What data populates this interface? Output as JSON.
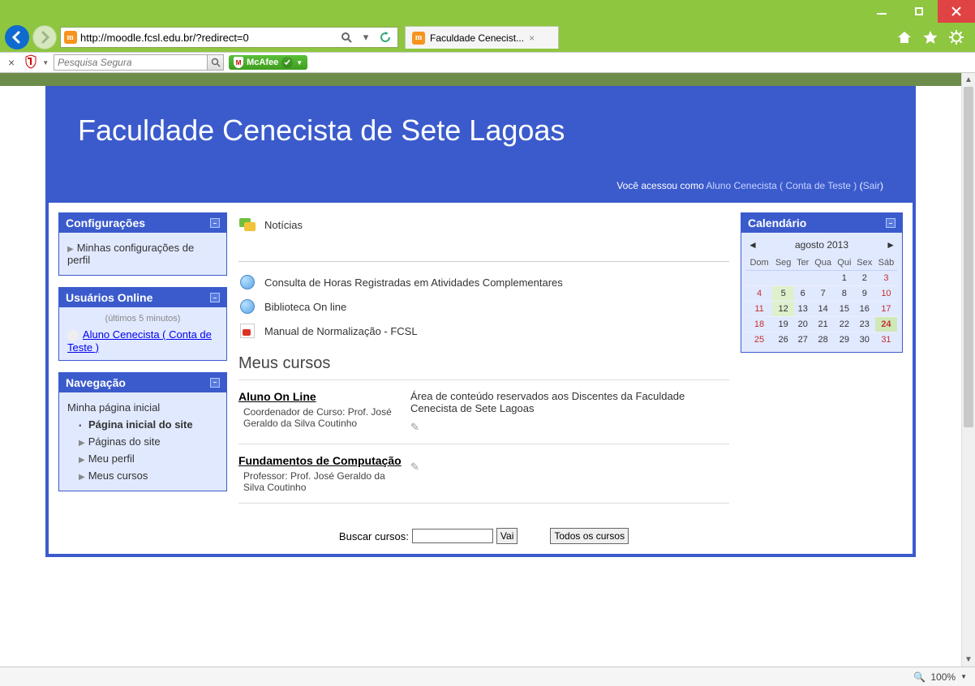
{
  "window": {
    "url": "http://moodle.fcsl.edu.br/?redirect=0",
    "tab_title": "Faculdade Cenecist...",
    "zoom": "100%"
  },
  "toolbar": {
    "search_placeholder": "Pesquisa Segura",
    "mcafee_label": "McAfee"
  },
  "header": {
    "title": "Faculdade Cenecista de Sete Lagoas",
    "login_prefix": "Você acessou como ",
    "user_link": "Aluno Cenecista ( Conta de Teste )",
    "logout_label": "Sair"
  },
  "blocks": {
    "config": {
      "title": "Configurações",
      "item1": "Minhas configurações de perfil"
    },
    "online": {
      "title": "Usuários Online",
      "sub": "(últimos 5 minutos)",
      "user": "Aluno Cenecista ( Conta de Teste )"
    },
    "nav": {
      "title": "Navegação",
      "home": "Minha página inicial",
      "site_home": "Página inicial do site",
      "site_pages": "Páginas do site",
      "profile": "Meu perfil",
      "courses": "Meus cursos"
    },
    "calendar": {
      "title": "Calendário",
      "month": "agosto 2013",
      "days": [
        "Dom",
        "Seg",
        "Ter",
        "Qua",
        "Qui",
        "Sex",
        "Sáb"
      ]
    }
  },
  "main": {
    "news": "Notícias",
    "link1": "Consulta de Horas Registradas em Atividades Complementares",
    "link2": "Biblioteca On line",
    "link3": "Manual de Normalização - FCSL",
    "mycourses": "Meus cursos",
    "course1": {
      "title": "Aluno On Line",
      "info": "Coordenador de Curso: Prof. José Geraldo da Silva Coutinho",
      "desc": "Área de conteúdo reservados aos Discentes da Faculdade Cenecista de Sete Lagoas"
    },
    "course2": {
      "title": "Fundamentos de Computação",
      "info": "Professor: Prof. José Geraldo da Silva Coutinho"
    },
    "search_label": "Buscar cursos:",
    "search_btn": "Vai",
    "all_btn": "Todos os cursos"
  }
}
